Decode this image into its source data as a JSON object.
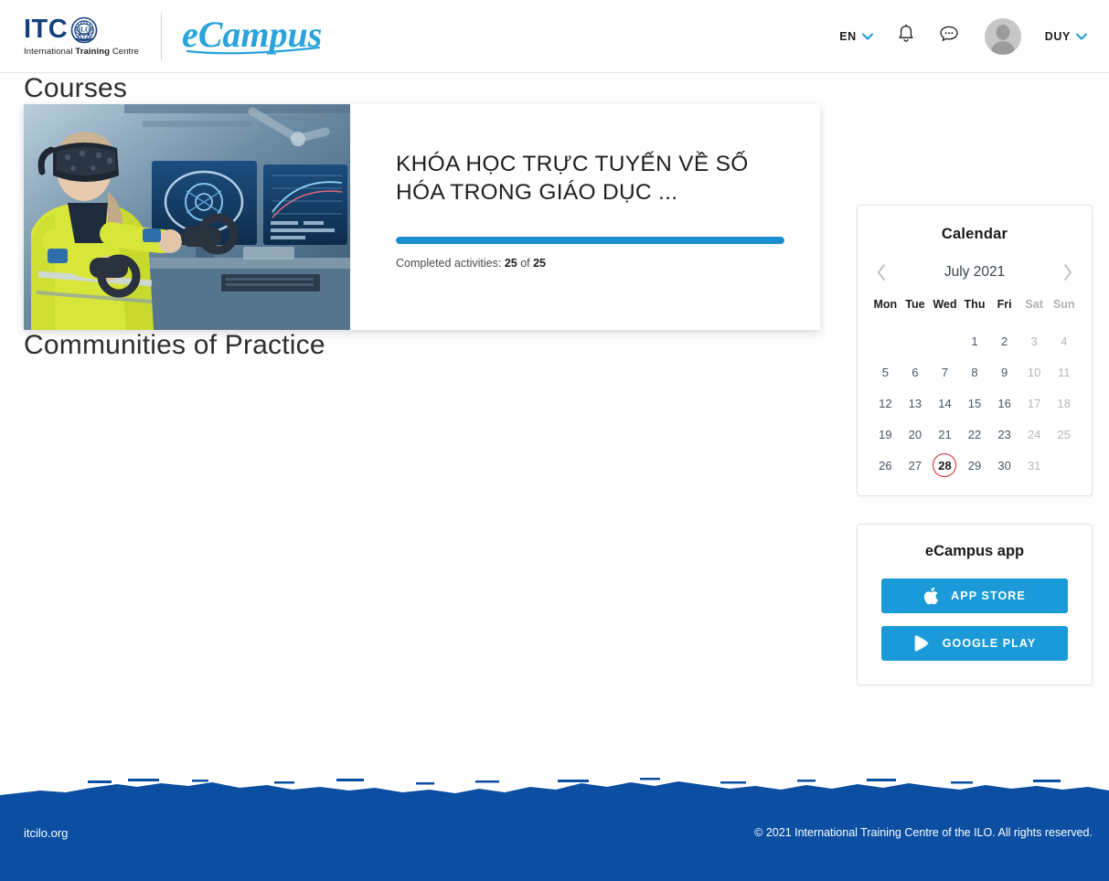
{
  "header": {
    "logo": {
      "itc_text": "ITC",
      "emblem": "ilo-emblem",
      "subtitle_before": "International ",
      "subtitle_bold": "Training",
      "subtitle_after": " Centre",
      "ecampus_text": "eCampus"
    },
    "language": {
      "label": "EN",
      "icon": "chevron-down-icon"
    },
    "notifications_icon": "bell-icon",
    "messages_icon": "chat-bubble-icon",
    "avatar_icon": "user-avatar-icon",
    "user": {
      "label": "DUY",
      "icon": "chevron-down-icon"
    }
  },
  "main": {
    "courses_heading": "Courses",
    "communities_heading": "Communities of Practice",
    "course_card": {
      "thumbnail_alt": "vr-headset-engineer-image",
      "title": "KHÓA HỌC TRỰC TUYẾN VỀ SỐ HÓA TRONG GIÁO DỤC ...",
      "progress_percent": 100,
      "progress_label_prefix": "Completed activities: ",
      "completed": "25",
      "progress_separator": " of ",
      "total": "25"
    }
  },
  "sidebar": {
    "calendar": {
      "title": "Calendar",
      "prev_icon": "chevron-left-icon",
      "next_icon": "chevron-right-icon",
      "month_label": "July 2021",
      "weekdays": [
        "Mon",
        "Tue",
        "Wed",
        "Thu",
        "Fri",
        "Sat",
        "Sun"
      ],
      "weekend_indices": [
        5,
        6
      ],
      "weeks": [
        [
          "",
          "",
          "",
          "1",
          "2",
          "3",
          "4"
        ],
        [
          "5",
          "6",
          "7",
          "8",
          "9",
          "10",
          "11"
        ],
        [
          "12",
          "13",
          "14",
          "15",
          "16",
          "17",
          "18"
        ],
        [
          "19",
          "20",
          "21",
          "22",
          "23",
          "24",
          "25"
        ],
        [
          "26",
          "27",
          "28",
          "29",
          "30",
          "31",
          ""
        ]
      ],
      "today": "28"
    },
    "app_panel": {
      "title": "eCampus app",
      "buttons": [
        {
          "label": "APP STORE",
          "icon": "apple-logo-icon"
        },
        {
          "label": "GOOGLE PLAY",
          "icon": "google-play-icon"
        }
      ]
    }
  },
  "footer": {
    "site_link": "itcilo.org",
    "copyright": "© 2021 International Training Centre of the ILO. All rights reserved."
  },
  "colors": {
    "brand_navy": "#15427e",
    "accent_blue": "#1a9ad8",
    "progress_blue": "#1c8fd2",
    "footer_blue": "#0b4ea2",
    "today_red": "#d8262c",
    "ecampus_cyan": "#29a3dc"
  }
}
